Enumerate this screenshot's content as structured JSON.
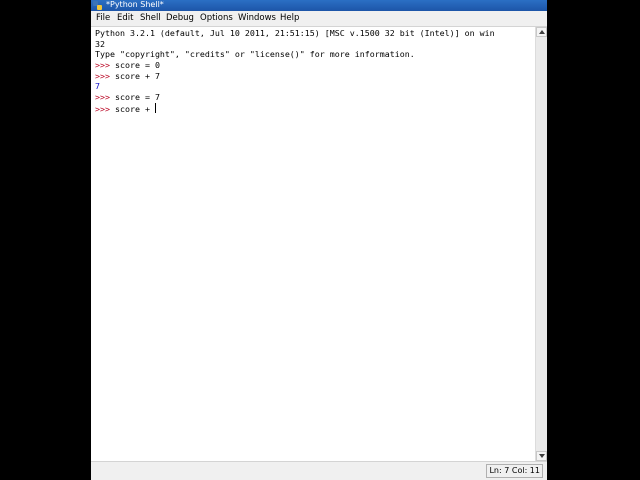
{
  "window": {
    "title": "*Python Shell*"
  },
  "menu": {
    "items": [
      "File",
      "Edit",
      "Shell",
      "Debug",
      "Options",
      "Windows",
      "Help"
    ]
  },
  "shell": {
    "banner_line1": "Python 3.2.1 (default, Jul 10 2011, 21:51:15) [MSC v.1500 32 bit (Intel)] on win",
    "banner_line2": "32",
    "banner_line3": "Type \"copyright\", \"credits\" or \"license()\" for more information.",
    "prompt": ">>> ",
    "cmd1": "score = 0",
    "cmd2": "score + 7",
    "out1": "7",
    "cmd3": "score = 7",
    "cmd4": "score + "
  },
  "status": {
    "position": "Ln: 7 Col: 11"
  },
  "colors": {
    "prompt": "#b8001f",
    "output": "#1010c8",
    "titlebar": "#2b6fc4"
  }
}
